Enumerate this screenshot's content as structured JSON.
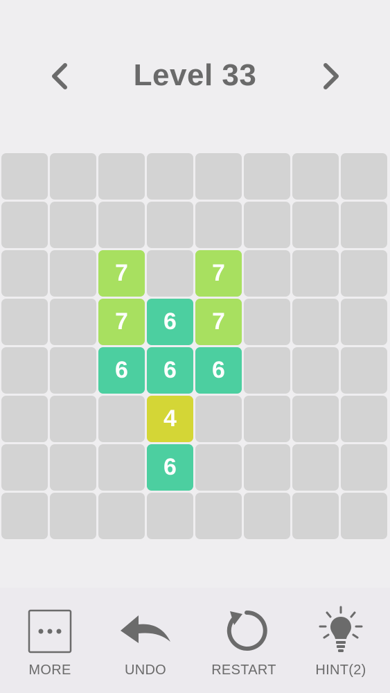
{
  "header": {
    "title": "Level 33",
    "prev_icon": "chevron-left-icon",
    "next_icon": "chevron-right-icon"
  },
  "board": {
    "rows": 8,
    "cols": 8,
    "tiles": [
      {
        "row": 2,
        "col": 2,
        "value": "7",
        "color": "#a8e060"
      },
      {
        "row": 2,
        "col": 4,
        "value": "7",
        "color": "#a8e060"
      },
      {
        "row": 3,
        "col": 2,
        "value": "7",
        "color": "#a8e060"
      },
      {
        "row": 3,
        "col": 3,
        "value": "6",
        "color": "#4ccfa0"
      },
      {
        "row": 3,
        "col": 4,
        "value": "7",
        "color": "#a8e060"
      },
      {
        "row": 4,
        "col": 2,
        "value": "6",
        "color": "#4ccfa0"
      },
      {
        "row": 4,
        "col": 3,
        "value": "6",
        "color": "#4ccfa0"
      },
      {
        "row": 4,
        "col": 4,
        "value": "6",
        "color": "#4ccfa0"
      },
      {
        "row": 5,
        "col": 3,
        "value": "4",
        "color": "#d4d636"
      },
      {
        "row": 6,
        "col": 3,
        "value": "6",
        "color": "#4ccfa0"
      }
    ]
  },
  "toolbar": {
    "more": {
      "label": "MORE",
      "icon": "more-dots-icon"
    },
    "undo": {
      "label": "UNDO",
      "icon": "undo-arrow-icon"
    },
    "restart": {
      "label": "RESTART",
      "icon": "restart-icon"
    },
    "hint": {
      "label": "HINT(2)",
      "icon": "lightbulb-icon"
    }
  },
  "colors": {
    "empty_cell": "#d3d3d3",
    "background": "#efeef0",
    "icon_gray": "#6b6b6b"
  }
}
